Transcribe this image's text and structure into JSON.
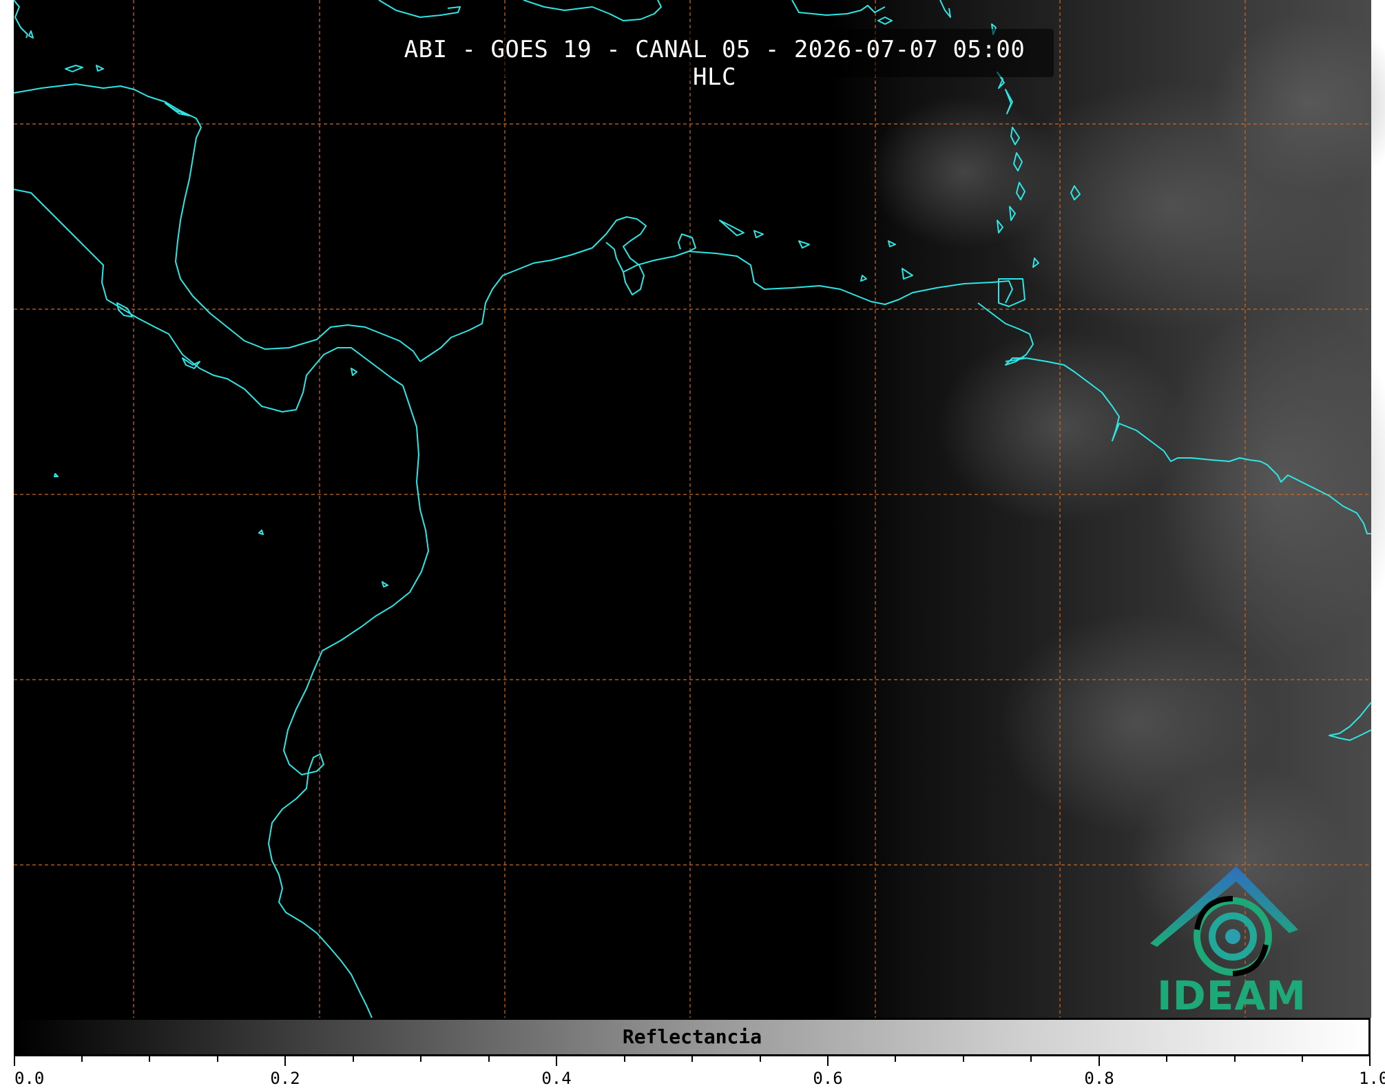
{
  "title": "ABI - GOES 19 - CANAL 05 - 2026-07-07 05:00 HLC",
  "colorbar": {
    "label": "Reflectancia",
    "ticks": [
      "0.0",
      "0.2",
      "0.4",
      "0.6",
      "0.8",
      "1.0"
    ],
    "range": [
      0.0,
      1.0
    ],
    "colormap": "grayscale"
  },
  "logo": {
    "text": "IDEAM"
  },
  "colors": {
    "coastline": "#2ee6e6",
    "grid": "#d2691e",
    "background": "#000000",
    "logo_green": "#1eaa78",
    "logo_blue": "#2f6fc0"
  }
}
